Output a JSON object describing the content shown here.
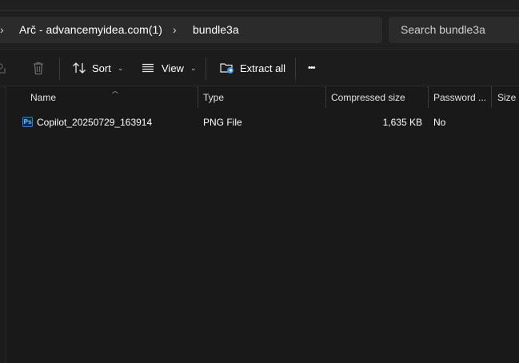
{
  "address": {
    "crumbs": [
      "Arč - advancemyidea.com(1)",
      "bundle3a"
    ],
    "search_placeholder": "Search bundle3a"
  },
  "toolbar": {
    "sort_label": "Sort",
    "view_label": "View",
    "extract_label": "Extract all",
    "more_label": "•••"
  },
  "columns": {
    "name": "Name",
    "type": "Type",
    "compressed_size": "Compressed size",
    "password": "Password ...",
    "size": "Size"
  },
  "files": [
    {
      "icon": "ps",
      "name": "Copilot_20250729_163914",
      "type": "PNG File",
      "compressed_size": "1,635 KB",
      "password": "No",
      "size": ""
    }
  ]
}
